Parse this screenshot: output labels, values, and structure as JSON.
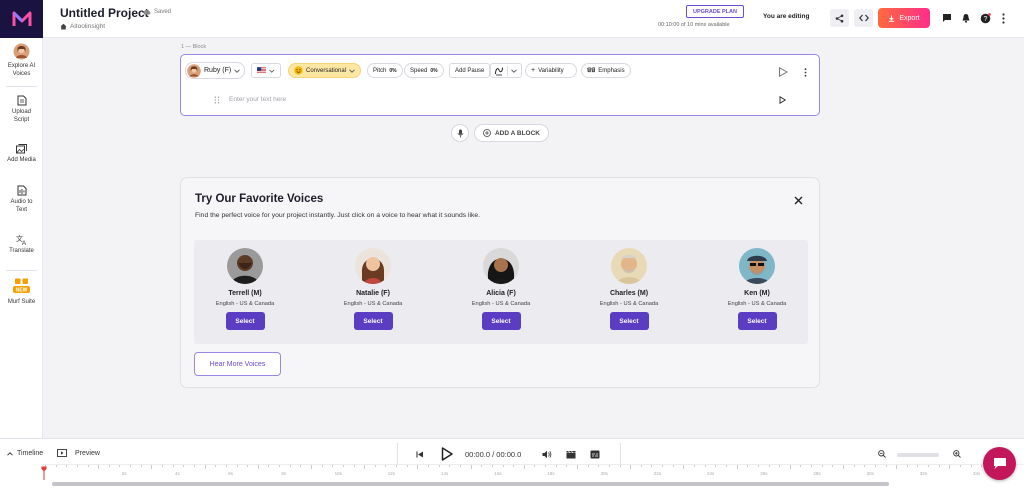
{
  "header": {
    "project_title": "Untitled Project",
    "saved_label": "Saved",
    "workspace": "Aitoolinsight",
    "upgrade_label": "UPGRADE PLAN",
    "usage": "00:10:00 of 10 mins available",
    "editing_label": "You are editing",
    "export_label": "Export"
  },
  "sidebar": {
    "items": [
      {
        "label": "Explore AI Voices"
      },
      {
        "label": "Upload Script"
      },
      {
        "label": "Add Media"
      },
      {
        "label": "Audio to Text"
      },
      {
        "label": "Translate"
      },
      {
        "label": "Murf Suite",
        "badge": "NEW"
      }
    ]
  },
  "block": {
    "label": "1 — Block",
    "voice": "Ruby (F)",
    "style": "Conversational",
    "pitch_label": "Pitch",
    "pitch_value": "0%",
    "speed_label": "Speed",
    "speed_value": "0%",
    "add_pause": "Add Pause",
    "variability": "Variability",
    "emphasis": "Emphasis",
    "text_placeholder": "Enter your text here"
  },
  "add_block_label": "ADD A BLOCK",
  "favorites": {
    "title": "Try Our Favorite Voices",
    "description": "Find the perfect voice for your project instantly. Just click on a voice to hear what it sounds like.",
    "voices": [
      {
        "name": "Terrell (M)",
        "lang": "English - US & Canada",
        "select": "Select"
      },
      {
        "name": "Natalie (F)",
        "lang": "English - US & Canada",
        "select": "Select"
      },
      {
        "name": "Alicia (F)",
        "lang": "English - US & Canada",
        "select": "Select"
      },
      {
        "name": "Charles (M)",
        "lang": "English - US & Canada",
        "select": "Select"
      },
      {
        "name": "Ken (M)",
        "lang": "English - US & Canada",
        "select": "Select"
      }
    ],
    "hear_more": "Hear More Voices"
  },
  "player": {
    "timeline_label": "Timeline",
    "preview_label": "Preview",
    "time": "00:00.0 / 00:00.0"
  },
  "ruler_ticks": [
    "0s",
    "2s",
    "4s",
    "6s",
    "8s",
    "10s",
    "12s",
    "14s",
    "16s",
    "18s",
    "20s",
    "22s",
    "24s",
    "26s",
    "28s",
    "30s",
    "32s",
    "34s",
    "36s"
  ],
  "colors": {
    "accent": "#5a3dc2",
    "export_start": "#ff6a3d",
    "export_end": "#ff2d8a",
    "logo_bg": "#1a1240"
  }
}
